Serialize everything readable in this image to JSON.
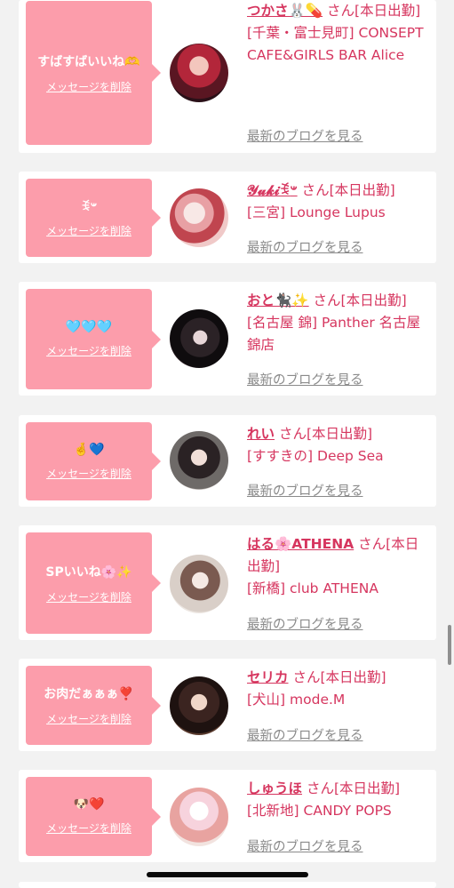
{
  "common": {
    "delete_label": "メッセージを削除",
    "blog_label": "最新のブログを見る",
    "san": "さん[本日出勤]"
  },
  "colors": {
    "accent_pink": "#fc9dab",
    "name_text": "#d6365f",
    "link_gray": "#8a8a8a"
  },
  "items": [
    {
      "message": "すばすばいいね🫶",
      "name": "つかさ🐰💊",
      "shop": "[千葉・富士見町] CONSEPT CAFE&GIRLS BAR Alice",
      "avatar_icon": "girl-avatar-red-hair"
    },
    {
      "message": "ꉂ𐤔",
      "name": "𝓨𝓾𝓴𝓲ꉂ𐤔",
      "shop": "[三宮] Lounge Lupus",
      "avatar_icon": "girl-avatar-hidden-face"
    },
    {
      "message": "🩵🩵🩵",
      "name": "おと🐈‍⬛✨",
      "shop": "[名古屋 錦] Panther 名古屋錦店",
      "avatar_icon": "girl-avatar-panther"
    },
    {
      "message": "🤞💙",
      "name": "れい",
      "shop": "[すすきの] Deep Sea",
      "avatar_icon": "girl-avatar-dark-hair"
    },
    {
      "message": "SPいいね🌸✨",
      "name": "はる🌸ATHENA",
      "shop": "[新橋] club ATHENA",
      "avatar_icon": "girl-avatar-long-hair"
    },
    {
      "message": "お肉だぁぁぁ❣️",
      "name": "セリカ",
      "shop": "[犬山] mode.M",
      "avatar_icon": "girl-avatar-dark-bg"
    },
    {
      "message": "🐶❤️",
      "name": "しゅうほ",
      "shop": "[北新地] CANDY POPS",
      "avatar_icon": "girl-avatar-bunny-sticker"
    }
  ]
}
